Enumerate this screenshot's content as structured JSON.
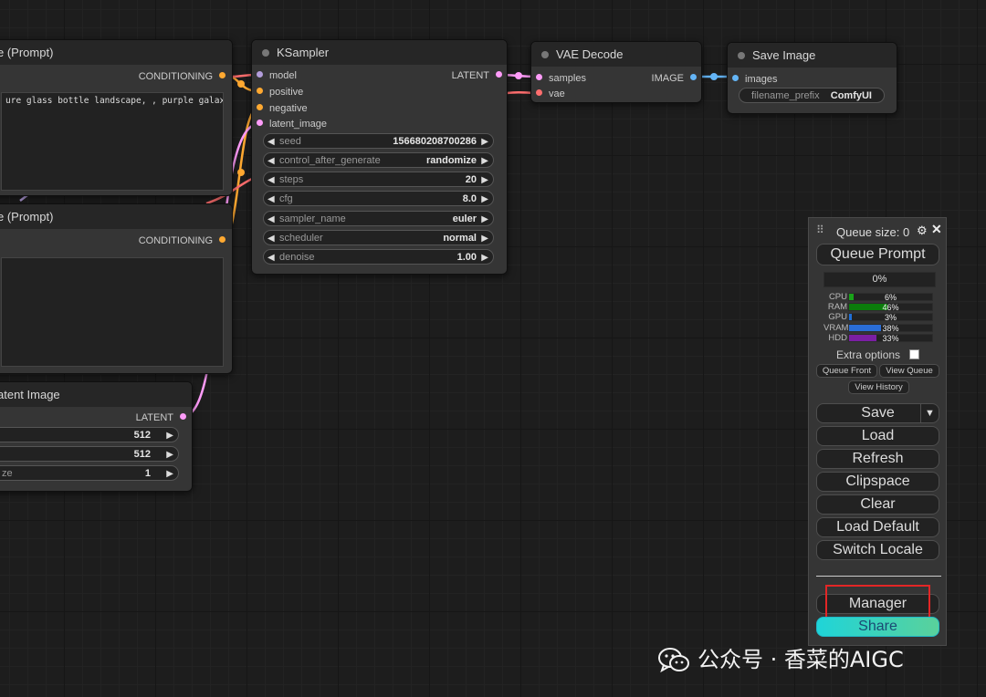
{
  "nodes": {
    "prompt_pos": {
      "title": "e (Prompt)",
      "output": "CONDITIONING",
      "text": "ure glass bottle landscape, , purple galaxy"
    },
    "prompt_neg": {
      "title": "e (Prompt)",
      "output": "CONDITIONING",
      "text": ""
    },
    "latent": {
      "title": "atent Image",
      "output": "LATENT",
      "widgets": [
        {
          "name": "",
          "value": "512"
        },
        {
          "name": "",
          "value": "512"
        },
        {
          "name": "ze",
          "value": "1"
        }
      ]
    },
    "ksampler": {
      "title": "KSampler",
      "inputs": [
        "model",
        "positive",
        "negative",
        "latent_image"
      ],
      "output": "LATENT",
      "widgets": [
        {
          "name": "seed",
          "value": "156680208700286"
        },
        {
          "name": "control_after_generate",
          "value": "randomize"
        },
        {
          "name": "steps",
          "value": "20"
        },
        {
          "name": "cfg",
          "value": "8.0"
        },
        {
          "name": "sampler_name",
          "value": "euler"
        },
        {
          "name": "scheduler",
          "value": "normal"
        },
        {
          "name": "denoise",
          "value": "1.00"
        }
      ]
    },
    "vae_decode": {
      "title": "VAE Decode",
      "inputs": [
        "samples",
        "vae"
      ],
      "output": "IMAGE"
    },
    "save_image": {
      "title": "Save Image",
      "inputs": [
        "images"
      ],
      "widgets": [
        {
          "name": "filename_prefix",
          "value": "ComfyUI"
        }
      ]
    }
  },
  "colors": {
    "model": "#b39ddb",
    "conditioning": "#ffa931",
    "latent": "#ff9cf9",
    "image": "#64b5f6",
    "vae": "#ff6e6e"
  },
  "menu": {
    "drag_handle": "⠿",
    "queue_size": "Queue size: 0",
    "settings_icon": "gear-icon",
    "close_icon": "close-icon",
    "queue_prompt": "Queue Prompt",
    "progress": "0%",
    "monitors": [
      {
        "label": "CPU",
        "percent": 6,
        "text": "6%",
        "color": "#19a319"
      },
      {
        "label": "RAM",
        "percent": 46,
        "text": "46%",
        "color": "#0b7c0b"
      },
      {
        "label": "GPU",
        "percent": 3,
        "text": "3%",
        "color": "#1f6fd6"
      },
      {
        "label": "VRAM",
        "percent": 38,
        "text": "38%",
        "color": "#2a6dd6"
      },
      {
        "label": "HDD",
        "percent": 33,
        "text": "33%",
        "color": "#7a1fa3"
      }
    ],
    "extra_options": "Extra options",
    "queue_front": "Queue Front",
    "view_queue": "View Queue",
    "view_history": "View History",
    "save": "Save",
    "save_dropdown": "▼",
    "load": "Load",
    "refresh": "Refresh",
    "clipspace": "Clipspace",
    "clear": "Clear",
    "load_default": "Load Default",
    "switch_locale": "Switch Locale",
    "manager": "Manager",
    "share": "Share"
  },
  "watermark": {
    "text": "公众号 · 香菜的AIGC",
    "icon": "wechat-icon"
  }
}
